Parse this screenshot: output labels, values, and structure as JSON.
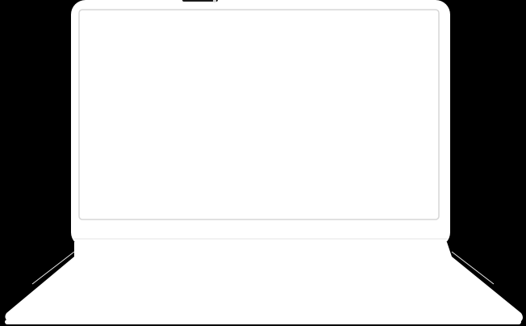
{
  "colors": {
    "background": "#000000",
    "laptop_body": "#ffffff",
    "outline": "#d6d6d6",
    "shadow_edge": "#bdbdbd"
  },
  "icons": {
    "device": "laptop-icon",
    "camera": "webcam-icon"
  }
}
